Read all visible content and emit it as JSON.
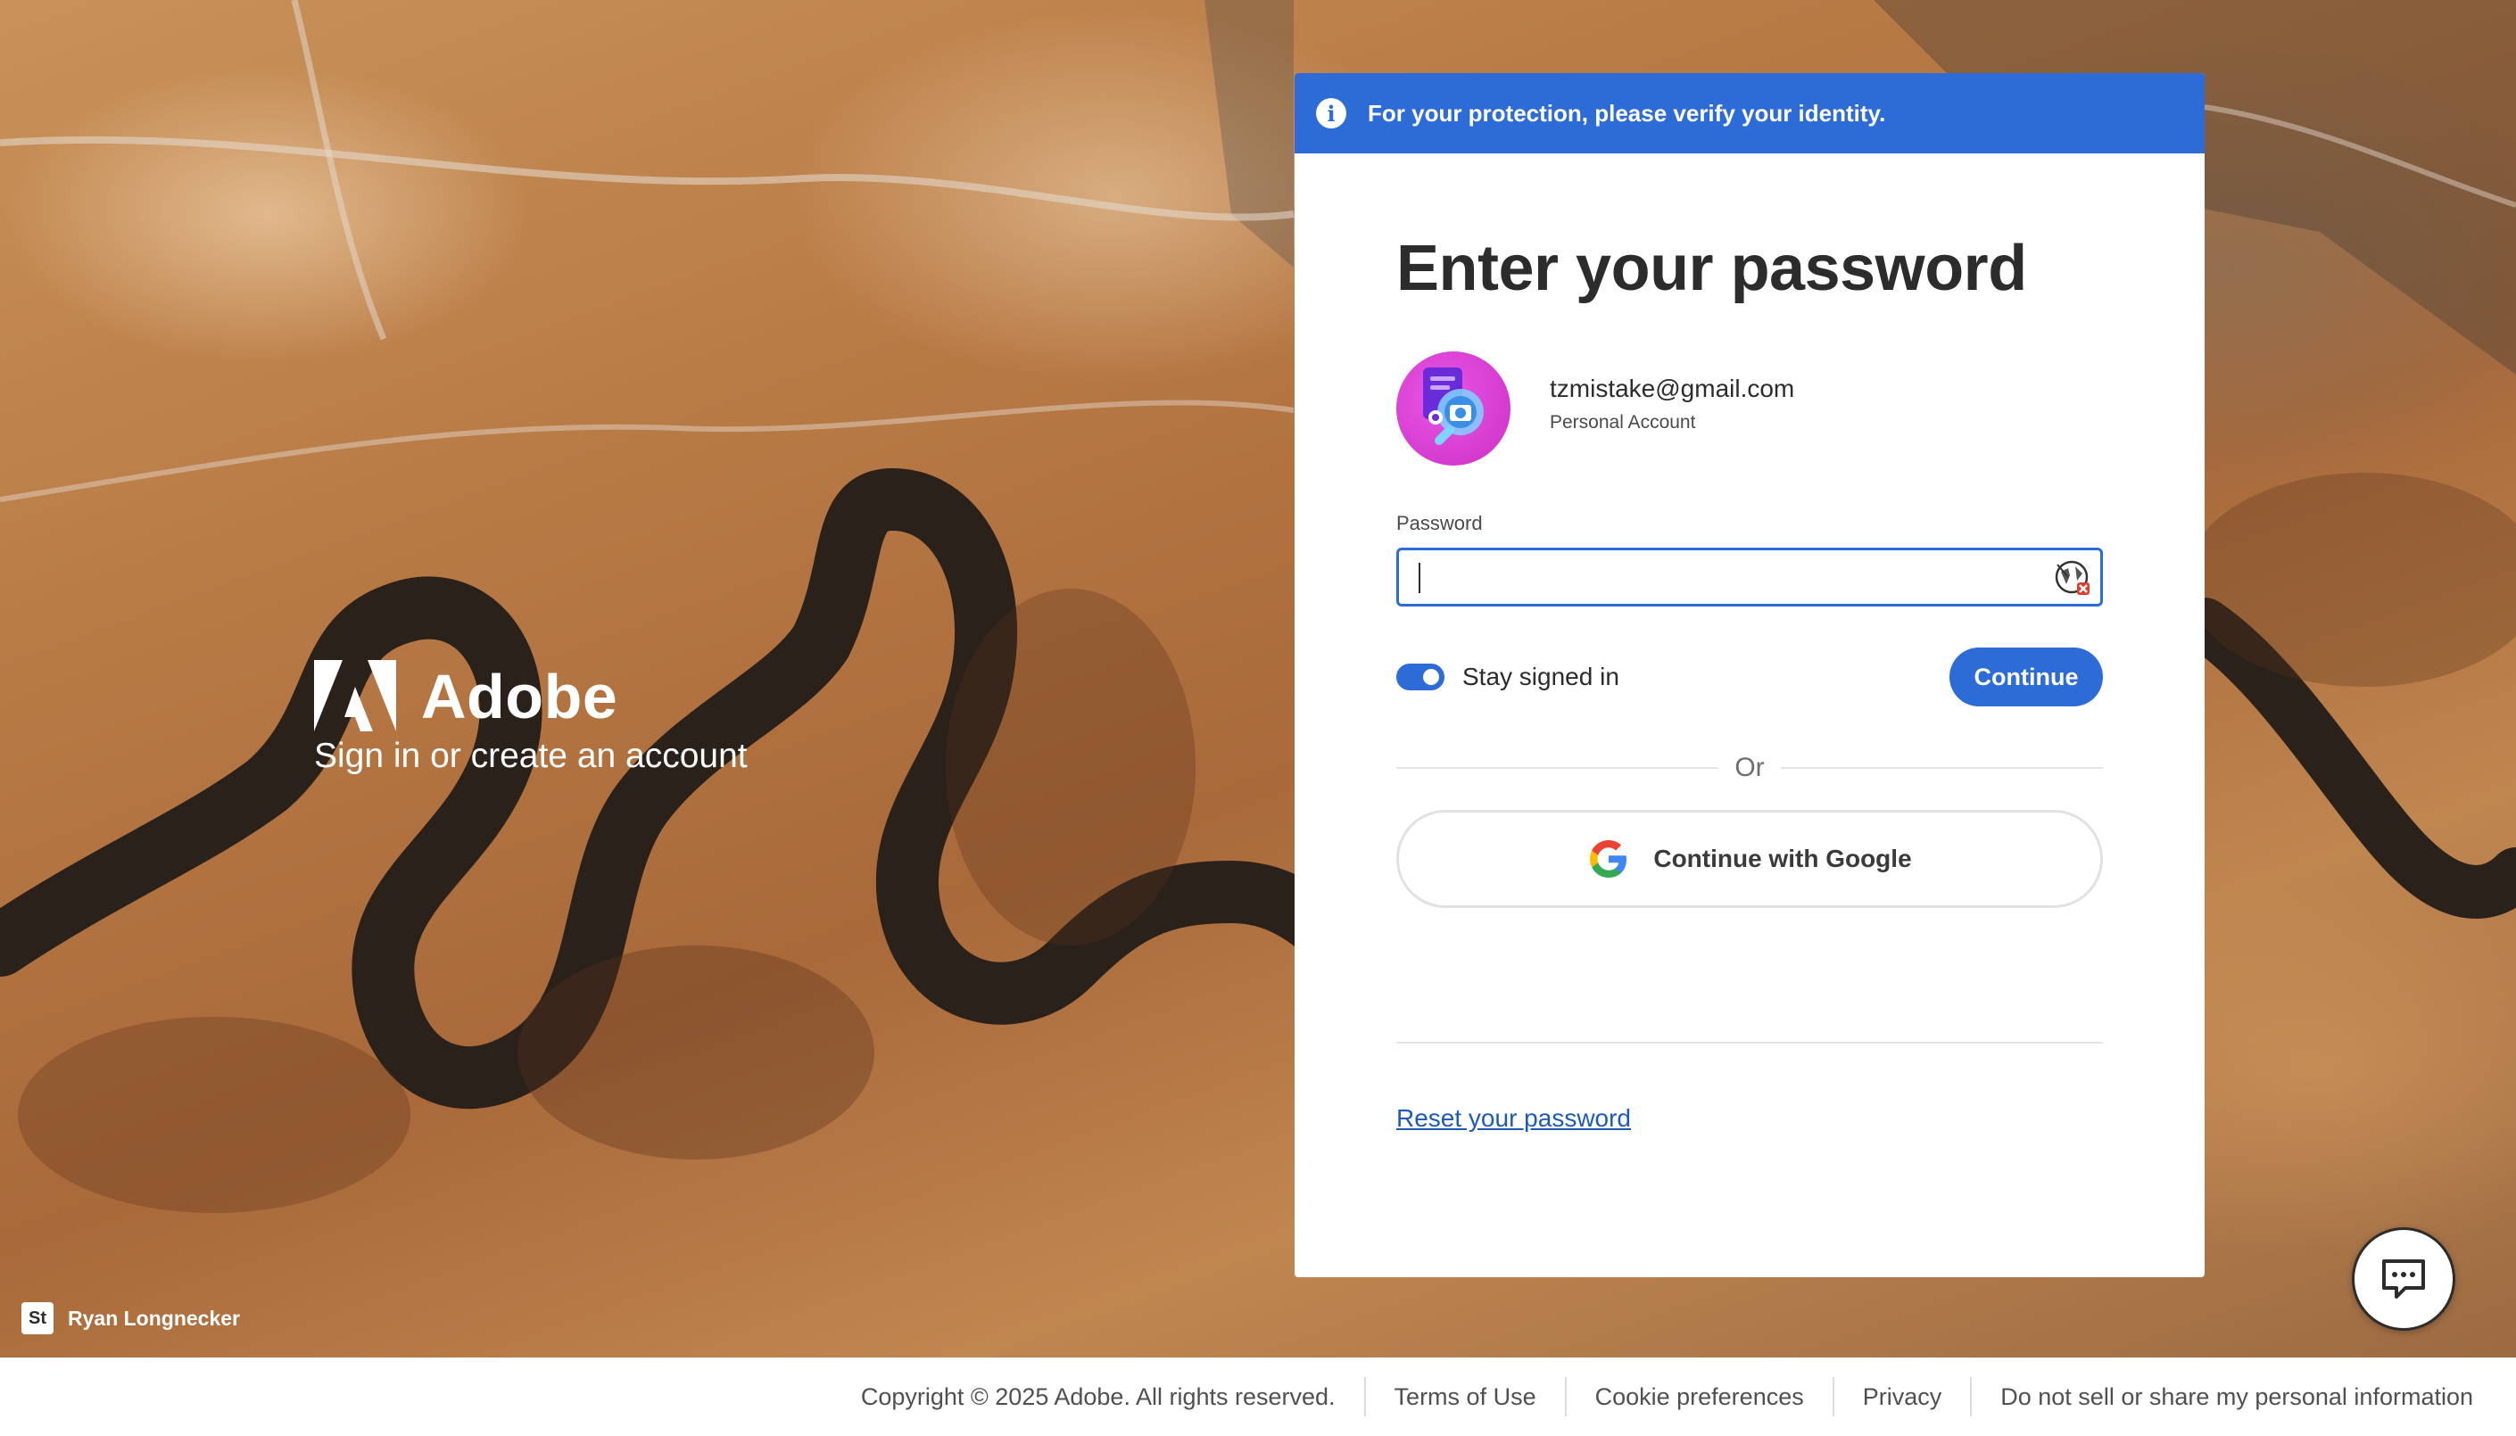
{
  "banner": {
    "icon": "info-icon",
    "text": "For your protection, please verify your identity."
  },
  "brand": {
    "name": "Adobe",
    "subtitle": "Sign in or create an account",
    "logo": "adobe-logo"
  },
  "photo_credit": {
    "badge": "St",
    "name": "Ryan Longnecker"
  },
  "form": {
    "title": "Enter your password",
    "account": {
      "email": "tzmistake@gmail.com",
      "type": "Personal Account"
    },
    "password_label": "Password",
    "password_value": "",
    "stay_signed_in": {
      "label": "Stay signed in",
      "checked": true
    },
    "continue_label": "Continue",
    "or_text": "Or",
    "google_label": "Continue with Google",
    "reset_link": "Reset your password"
  },
  "footer": {
    "copyright": "Copyright © 2025 Adobe. All rights reserved.",
    "links": [
      "Terms of Use",
      "Cookie preferences",
      "Privacy",
      "Do not sell or share my personal information"
    ]
  },
  "colors": {
    "accent": "#2d6bd6",
    "link": "#1e5bb8",
    "avatar": "#d93ad3"
  }
}
